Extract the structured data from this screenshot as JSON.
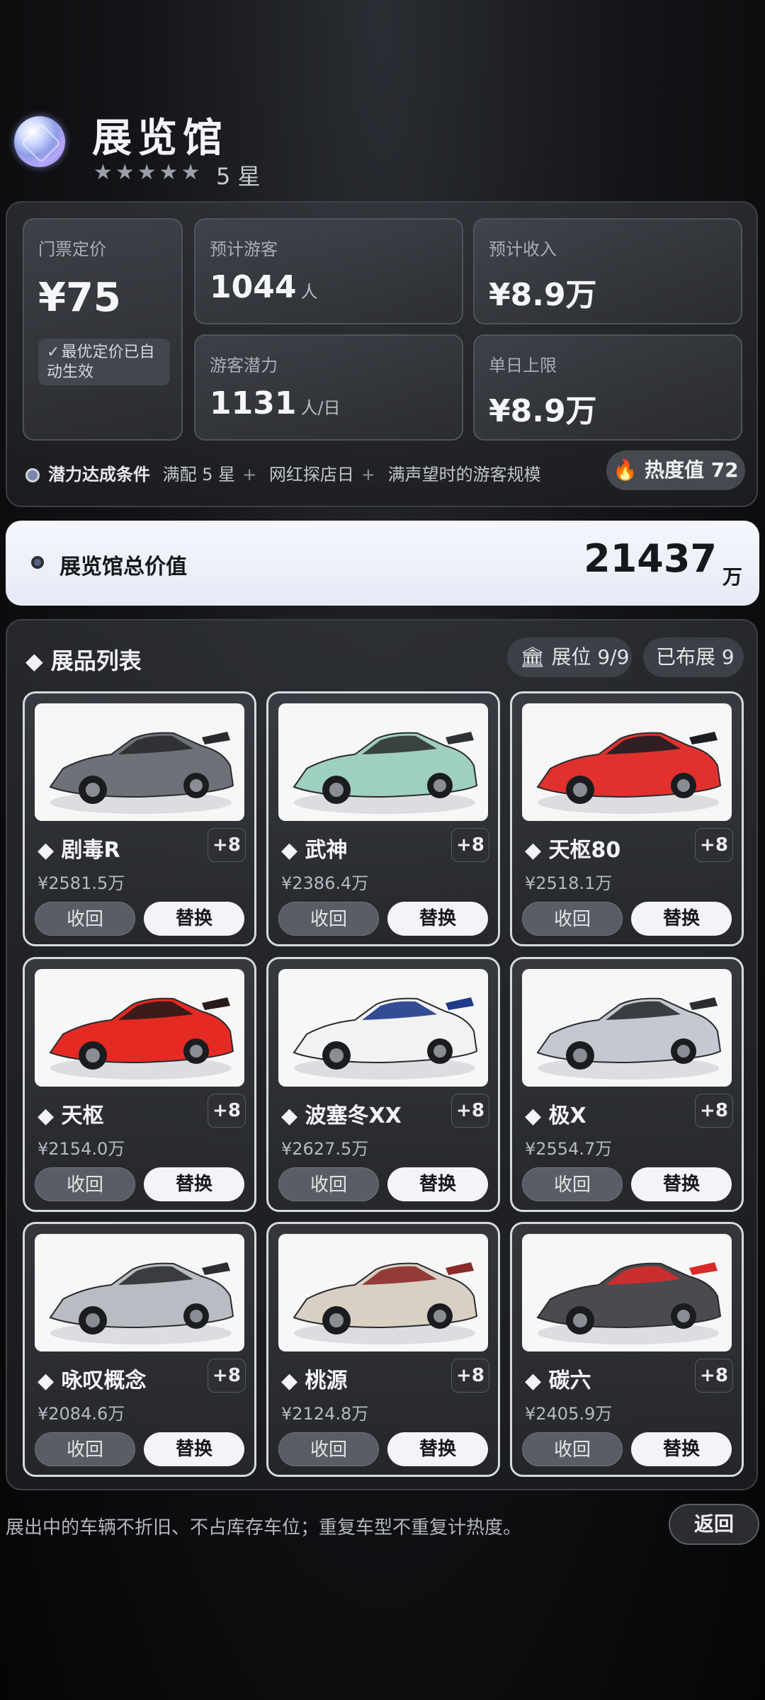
{
  "header": {
    "title": "展览馆",
    "stars": "★★★★★",
    "stars_text": "5 星"
  },
  "stats": {
    "ticket": {
      "label": "门票定价",
      "value": "¥75",
      "note": "最优定价已自动生效"
    },
    "visitors": {
      "label": "预计游客",
      "value": "1044",
      "unit": "人"
    },
    "income": {
      "label": "预计收入",
      "value": "¥8.9万"
    },
    "potential": {
      "label": "游客潜力",
      "value": "1131",
      "unit": "人/日"
    },
    "daily_cap": {
      "label": "单日上限",
      "value": "¥8.9万"
    }
  },
  "conditions": {
    "label": "潜力达成条件",
    "items": [
      "满配 5 星",
      "网红探店日",
      "满声望时的游客规模"
    ]
  },
  "heat": {
    "label": "热度值 72"
  },
  "total": {
    "label": "展览馆总价值",
    "value": "21437",
    "unit": "万"
  },
  "list": {
    "title": "展品列表",
    "slots": "展位 9/9",
    "exhibited": "已布展 9",
    "cars": [
      {
        "name": "剧毒R",
        "bonus": "+8",
        "value": "¥2581.5万",
        "back": "收回",
        "swap": "替换"
      },
      {
        "name": "武神",
        "bonus": "+8",
        "value": "¥2386.4万",
        "back": "收回",
        "swap": "替换"
      },
      {
        "name": "天枢80",
        "bonus": "+8",
        "value": "¥2518.1万",
        "back": "收回",
        "swap": "替换"
      },
      {
        "name": "天枢",
        "bonus": "+8",
        "value": "¥2154.0万",
        "back": "收回",
        "swap": "替换"
      },
      {
        "name": "波塞冬XX",
        "bonus": "+8",
        "value": "¥2627.5万",
        "back": "收回",
        "swap": "替换"
      },
      {
        "name": "极X",
        "bonus": "+8",
        "value": "¥2554.7万",
        "back": "收回",
        "swap": "替换"
      },
      {
        "name": "咏叹概念",
        "bonus": "+8",
        "value": "¥2084.6万",
        "back": "收回",
        "swap": "替换"
      },
      {
        "name": "桃源",
        "bonus": "+8",
        "value": "¥2124.8万",
        "back": "收回",
        "swap": "替换"
      },
      {
        "name": "碳六",
        "bonus": "+8",
        "value": "¥2405.9万",
        "back": "收回",
        "swap": "替换"
      }
    ]
  },
  "footer": {
    "note": "展出中的车辆不折旧、不占库存车位；重复车型不重复计热度。",
    "return": "返回"
  },
  "colors": {
    "car_bodies": [
      "#6e7178",
      "#9fcfbe",
      "#e0312f",
      "#e52a23",
      "#f2f2f2",
      "#c4c9d1",
      "#b9bcc2",
      "#d9d0c4",
      "#4a4b4f"
    ],
    "car_accents": [
      "#2a2b2e",
      "#2f3234",
      "#1d1e21",
      "#2a1a1a",
      "#1f3a8a",
      "#2b2d31",
      "#2d2e32",
      "#8b2a2a",
      "#d92a2a"
    ]
  }
}
